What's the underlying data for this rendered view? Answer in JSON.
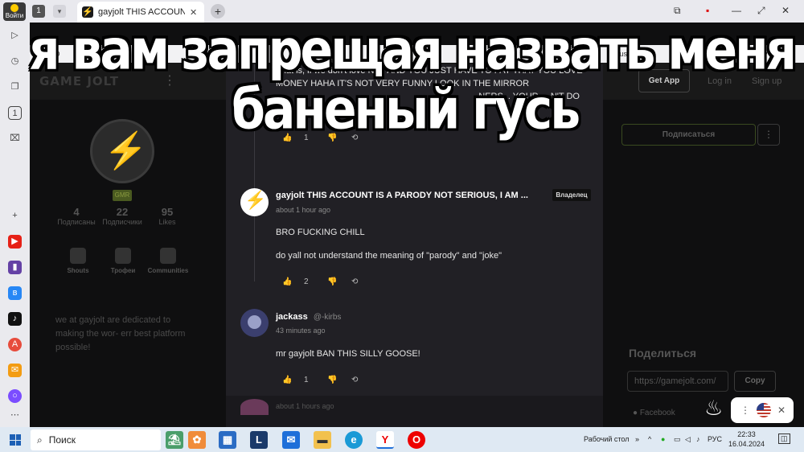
{
  "browser": {
    "login_label": "Войти",
    "tab_counter": "1",
    "tab_title": "gayjolt THIS ACCOUNT IS A PARODY",
    "tab_close": "✕",
    "newtab": "+",
    "controls": [
      "⧉",
      "▪",
      "—",
      "⤢",
      "✕"
    ]
  },
  "site": {
    "logo": "GAME JOLT",
    "get_app": "Get App",
    "login": "Log in",
    "signup": "Sign up",
    "bookmarks": [
      "K ID",
      "",
      "",
      "",
      "",
      "",
      "",
      "",
      "",
      "use",
      "ctiv"
    ]
  },
  "profile": {
    "badge": "GMR",
    "stats": [
      {
        "value": "4",
        "label": "Подписаны"
      },
      {
        "value": "22",
        "label": "Подписчики"
      },
      {
        "value": "95",
        "label": "Likes"
      }
    ],
    "tabs": [
      "Shouts",
      "Трофеи",
      "Communities"
    ],
    "bio": "we at gayjolt are dedicated to making the wor- err best platform possible!",
    "subscribe": "Подписаться",
    "share_title": "Поделиться",
    "share_url": "https://gamejolt.com/",
    "copy": "Copy",
    "facebook": "Facebook"
  },
  "comments": {
    "partial_text": "That is, if we don't love NFT AND YOU JUST HAVE TO PAY THAT YOU LOVE MONEY HAHA IT'S NOT VERY FUNNY LOOK IN THE MIRROR",
    "partial_text_2": "NERS... YOUR ... N'T DO",
    "partial_likes": "1",
    "items": [
      {
        "name": "gayjolt THIS ACCOUNT IS A PARODY NOT SERIOUS, I AM ...",
        "handle": "",
        "badge": "Владелец",
        "time": "about 1 hour ago",
        "lines": [
          "BRO FUCKING CHILL",
          "do yall not understand the meaning of \"parody\" and \"joke\""
        ],
        "likes": "2"
      },
      {
        "name": "jackass",
        "handle": "@-kirbs",
        "badge": "",
        "time": "43 minutes ago",
        "lines": [
          "mr gayjolt BAN THIS SILLY GOOSE!"
        ],
        "likes": "1"
      }
    ],
    "bottom_time": "about 1 hours ago"
  },
  "meme": {
    "line1": "я вам запрещая назвать меня",
    "line2": "баненый гусь"
  },
  "popup": {
    "menu": "⋮",
    "close": "✕"
  },
  "taskbar": {
    "search": "Поиск",
    "desktop": "Рабочий стол",
    "lang": "РУС",
    "time": "22:33",
    "date": "16.04.2024"
  },
  "colors": {
    "gj_green": "#2ecc40",
    "modal_bg": "#212025",
    "page_bg": "#0f0f10"
  }
}
